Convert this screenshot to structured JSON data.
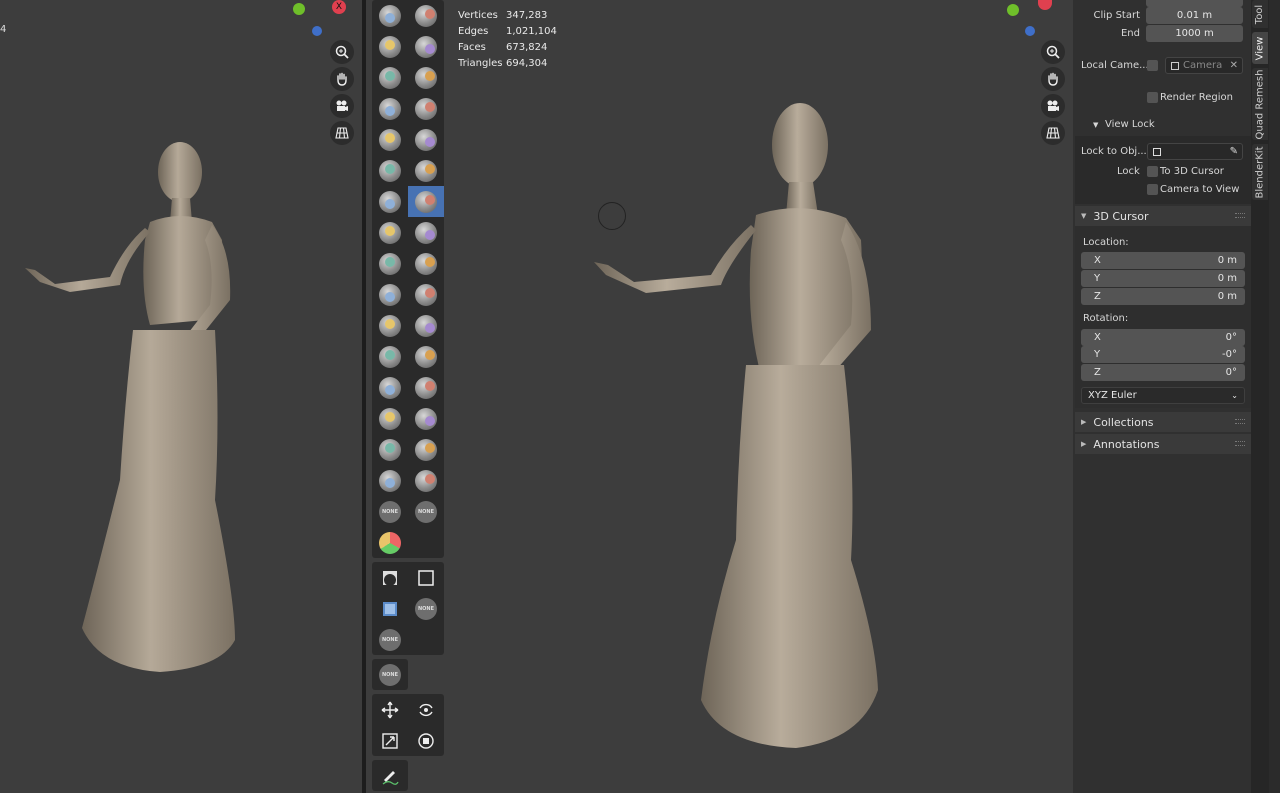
{
  "stats": {
    "rows": [
      {
        "label": "Vertices",
        "value": "347,283"
      },
      {
        "label": "Edges",
        "value": "1,021,104"
      },
      {
        "label": "Faces",
        "value": "673,824"
      },
      {
        "label": "Triangles",
        "value": "694,304"
      }
    ]
  },
  "left_viewport": {
    "corner_glyph": "4"
  },
  "gizmo": {
    "x_label": "X"
  },
  "toolbar": {
    "none_label": "NONE",
    "brushes": [
      "draw",
      "draw-sharp",
      "clay",
      "clay-strips",
      "clay-thumb",
      "layer",
      "inflate",
      "blob",
      "crease",
      "smooth",
      "flatten",
      "fill",
      "scrape",
      "multiplane-scrape",
      "pinch",
      "grab",
      "elastic-deform",
      "snake-hook",
      "thumb",
      "pose",
      "nudge",
      "rotate",
      "slide-relax",
      "boundary",
      "cloth",
      "simplify",
      "mask",
      "draw-face-sets",
      "multires-displacement-eraser",
      "multires-displacement-smear",
      "paint",
      "smear"
    ],
    "active_index": 13
  },
  "properties": {
    "clip_start_label": "Clip Start",
    "clip_start_value": "0.01 m",
    "clip_end_label": "End",
    "clip_end_value": "1000 m",
    "local_camera_label": "Local Came...",
    "camera_placeholder": "Camera",
    "render_region_label": "Render Region",
    "view_lock_title": "View Lock",
    "lock_to_object_label": "Lock to Obj...",
    "lock_label": "Lock",
    "to_3d_cursor_label": "To 3D Cursor",
    "camera_to_view_label": "Camera to View",
    "cursor_title": "3D Cursor",
    "location_label": "Location:",
    "location": [
      {
        "axis": "X",
        "value": "0 m"
      },
      {
        "axis": "Y",
        "value": "0 m"
      },
      {
        "axis": "Z",
        "value": "0 m"
      }
    ],
    "rotation_label": "Rotation:",
    "rotation": [
      {
        "axis": "X",
        "value": "0°"
      },
      {
        "axis": "Y",
        "value": "-0°"
      },
      {
        "axis": "Z",
        "value": "0°"
      }
    ],
    "rotation_mode": "XYZ Euler",
    "collections_title": "Collections",
    "annotations_title": "Annotations"
  },
  "tabs": [
    {
      "label": "Tool",
      "active": false
    },
    {
      "label": "View",
      "active": true
    },
    {
      "label": "Quad Remesh",
      "active": false
    },
    {
      "label": "BlenderKit",
      "active": false
    }
  ],
  "colors": {
    "viewport_bg": "#3d3d3d",
    "panel_bg": "#303030",
    "field_bg": "#545454",
    "active_blue": "#4772b3",
    "axis_x": "#e0404f",
    "axis_y": "#6fbf2a",
    "axis_z": "#3f6fc9",
    "figure_clay": "#a89c8c"
  }
}
